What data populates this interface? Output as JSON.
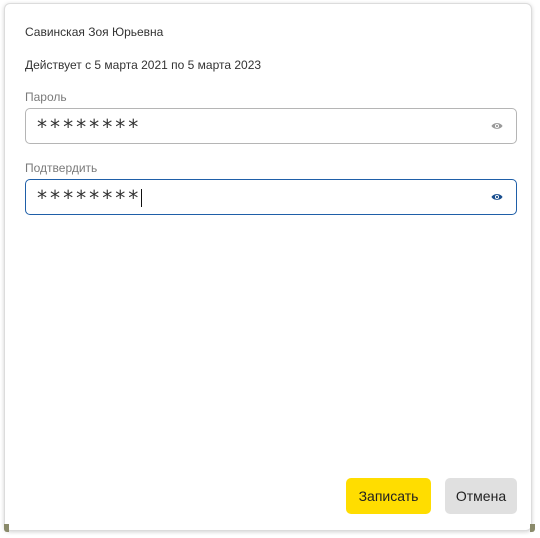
{
  "dialog": {
    "owner_name": "Савинская Зоя Юрьевна",
    "validity": "Действует с 5 марта 2021 по 5 марта 2023"
  },
  "password": {
    "label": "Пароль",
    "value": "********",
    "icon": "eye-icon"
  },
  "confirm": {
    "label": "Подтвердить",
    "value": "********",
    "icon": "eye-icon"
  },
  "buttons": {
    "save_label": "Записать",
    "cancel_label": "Отмена"
  },
  "colors": {
    "accent_yellow": "#ffdd00",
    "focus_blue": "#1f5fa8",
    "cancel_gray": "#e0e0e0"
  }
}
